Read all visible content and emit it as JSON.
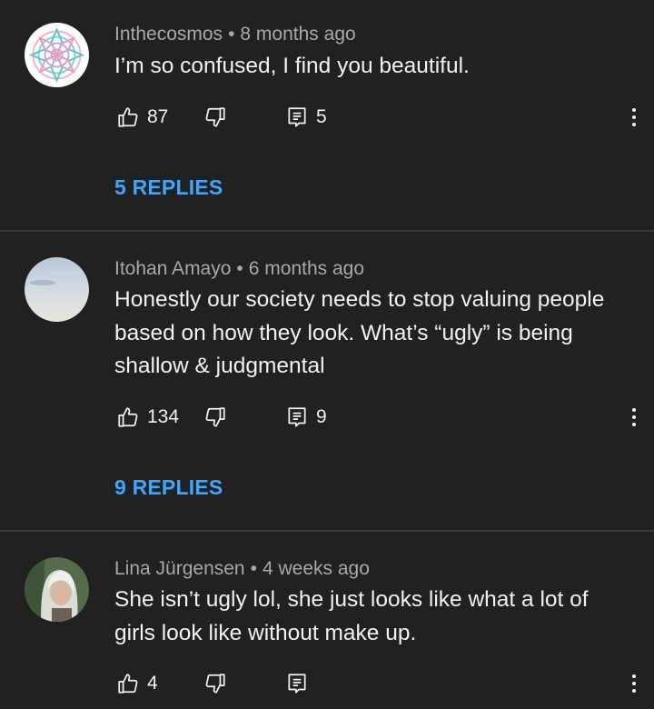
{
  "comments": [
    {
      "author": "Inthecosmos",
      "time": "8 months ago",
      "text": "I’m so confused, I find you beautiful.",
      "likes": "87",
      "reply_count": "5",
      "replies_label": "5 REPLIES",
      "avatar": "mandala-avatar"
    },
    {
      "author": "Itohan Amayo",
      "time": "6 months ago",
      "text": "Honestly our society needs to stop valuing people based on how they look. What’s “ugly” is being shallow & judgmental",
      "likes": "134",
      "reply_count": "9",
      "replies_label": "9 REPLIES",
      "avatar": "sky-avatar"
    },
    {
      "author": "Lina Jürgensen",
      "time": "4 weeks ago",
      "text": "She isn’t ugly lol, she just looks like what a lot of girls look like without make up.",
      "likes": "4",
      "reply_count": "",
      "avatar": "portrait-avatar"
    }
  ],
  "separator": "•",
  "colors": {
    "background": "#212121",
    "text": "#f1f1f1",
    "meta": "#a8a8a8",
    "link": "#3ea6ff",
    "divider": "#3a3a3a"
  },
  "icons": [
    "thumbs-up-icon",
    "thumbs-down-icon",
    "reply-icon",
    "more-vert-icon"
  ]
}
